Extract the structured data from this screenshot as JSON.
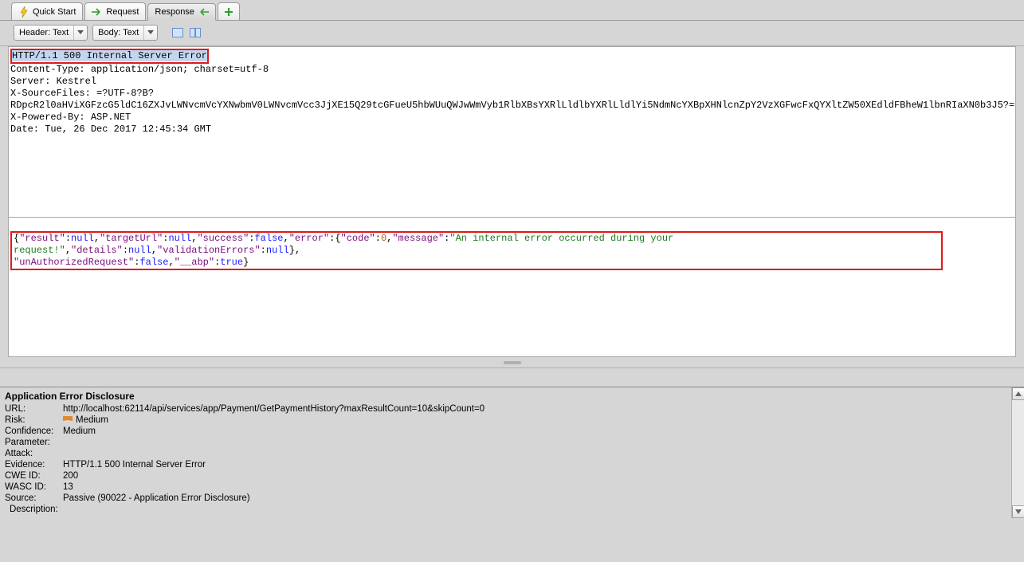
{
  "tabs": {
    "quickstart": "Quick Start",
    "request": "Request",
    "response": "Response"
  },
  "toolbar": {
    "header_dd": "Header: Text",
    "body_dd": "Body: Text"
  },
  "response_header": {
    "status_line": "HTTP/1.1 500 Internal Server Error",
    "lines": [
      "Content-Type: application/json; charset=utf-8",
      "Server: Kestrel",
      "X-SourceFiles: =?UTF-8?B?",
      "RDpcR2l0aHViXGFzcG5ldC16ZXJvLWNvcmVcYXNwbmV0LWNvcmVcc3JjXE15Q29tcGFueU5hbWUuQWJwWmVyb1RlbXBsYXRlLldlbYXRlLldlYi5NdmNcYXBpXHNlcnZpY2VzXGFwcFxQYXltZW50XEdldFBheW1lbnRIaXN0b3J5?=",
      "X-Powered-By: ASP.NET",
      "Date: Tue, 26 Dec 2017 12:45:34 GMT"
    ]
  },
  "response_body_tokens": [
    {
      "t": "p",
      "v": "{"
    },
    {
      "t": "k",
      "v": "\"result\""
    },
    {
      "t": "p",
      "v": ":"
    },
    {
      "t": "n",
      "v": "null"
    },
    {
      "t": "p",
      "v": ","
    },
    {
      "t": "k",
      "v": "\"targetUrl\""
    },
    {
      "t": "p",
      "v": ":"
    },
    {
      "t": "n",
      "v": "null"
    },
    {
      "t": "p",
      "v": ","
    },
    {
      "t": "k",
      "v": "\"success\""
    },
    {
      "t": "p",
      "v": ":"
    },
    {
      "t": "f",
      "v": "false"
    },
    {
      "t": "p",
      "v": ","
    },
    {
      "t": "k",
      "v": "\"error\""
    },
    {
      "t": "p",
      "v": ":{"
    },
    {
      "t": "k",
      "v": "\"code\""
    },
    {
      "t": "p",
      "v": ":"
    },
    {
      "t": "num",
      "v": "0"
    },
    {
      "t": "p",
      "v": ","
    },
    {
      "t": "k",
      "v": "\"message\""
    },
    {
      "t": "p",
      "v": ":"
    },
    {
      "t": "s",
      "v": "\"An internal error occurred during your request!\""
    },
    {
      "t": "p",
      "v": ","
    },
    {
      "t": "k",
      "v": "\"details\""
    },
    {
      "t": "p",
      "v": ":"
    },
    {
      "t": "n",
      "v": "null"
    },
    {
      "t": "p",
      "v": ","
    },
    {
      "t": "k",
      "v": "\"validationErrors\""
    },
    {
      "t": "p",
      "v": ":"
    },
    {
      "t": "n",
      "v": "null"
    },
    {
      "t": "p",
      "v": "},"
    },
    {
      "t": "br",
      "v": ""
    },
    {
      "t": "k",
      "v": "\"unAuthorizedRequest\""
    },
    {
      "t": "p",
      "v": ":"
    },
    {
      "t": "f",
      "v": "false"
    },
    {
      "t": "p",
      "v": ","
    },
    {
      "t": "k",
      "v": "\"__abp\""
    },
    {
      "t": "p",
      "v": ":"
    },
    {
      "t": "f",
      "v": "true"
    },
    {
      "t": "p",
      "v": "}"
    }
  ],
  "alert": {
    "title": "Application Error Disclosure",
    "url_label": "URL:",
    "url_value": "http://localhost:62114/api/services/app/Payment/GetPaymentHistory?maxResultCount=10&skipCount=0",
    "risk_label": "Risk:",
    "risk_value": "Medium",
    "confidence_label": "Confidence:",
    "confidence_value": "Medium",
    "parameter_label": "Parameter:",
    "parameter_value": "",
    "attack_label": "Attack:",
    "attack_value": "",
    "evidence_label": "Evidence:",
    "evidence_value": "HTTP/1.1 500 Internal Server Error",
    "cwe_label": "CWE ID:",
    "cwe_value": "200",
    "wasc_label": "WASC ID:",
    "wasc_value": "13",
    "source_label": "Source:",
    "source_value": "Passive (90022 - Application Error Disclosure)",
    "description_label": "Description:"
  }
}
